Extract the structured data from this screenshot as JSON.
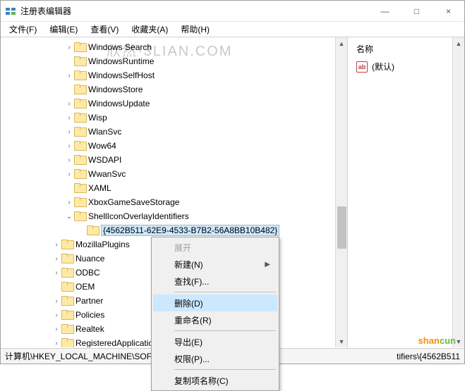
{
  "window": {
    "title": "注册表编辑器",
    "min": "—",
    "max": "□",
    "close": "×"
  },
  "menubar": [
    "文件(F)",
    "编辑(E)",
    "查看(V)",
    "收藏夹(A)",
    "帮助(H)"
  ],
  "watermark": "欣然·3LIAN.COM",
  "tree": {
    "items": [
      {
        "depth": 5,
        "exp": "›",
        "label": "Windows Search"
      },
      {
        "depth": 5,
        "exp": "",
        "label": "WindowsRuntime"
      },
      {
        "depth": 5,
        "exp": "›",
        "label": "WindowsSelfHost"
      },
      {
        "depth": 5,
        "exp": "",
        "label": "WindowsStore"
      },
      {
        "depth": 5,
        "exp": "›",
        "label": "WindowsUpdate"
      },
      {
        "depth": 5,
        "exp": "›",
        "label": "Wisp"
      },
      {
        "depth": 5,
        "exp": "›",
        "label": "WlanSvc"
      },
      {
        "depth": 5,
        "exp": "›",
        "label": "Wow64"
      },
      {
        "depth": 5,
        "exp": "›",
        "label": "WSDAPI"
      },
      {
        "depth": 5,
        "exp": "›",
        "label": "WwanSvc"
      },
      {
        "depth": 5,
        "exp": "",
        "label": "XAML"
      },
      {
        "depth": 5,
        "exp": "›",
        "label": "XboxGameSaveStorage"
      },
      {
        "depth": 5,
        "exp": "⌄",
        "label": "ShellIconOverlayIdentifiers"
      },
      {
        "depth": 6,
        "exp": "",
        "label": "{4562B511-62E9-4533-B7B2-56A8BB10B482}",
        "selected": true
      },
      {
        "depth": 4,
        "exp": "›",
        "label": "MozillaPlugins"
      },
      {
        "depth": 4,
        "exp": "›",
        "label": "Nuance"
      },
      {
        "depth": 4,
        "exp": "›",
        "label": "ODBC"
      },
      {
        "depth": 4,
        "exp": "",
        "label": "OEM"
      },
      {
        "depth": 4,
        "exp": "›",
        "label": "Partner"
      },
      {
        "depth": 4,
        "exp": "›",
        "label": "Policies"
      },
      {
        "depth": 4,
        "exp": "›",
        "label": "Realtek"
      },
      {
        "depth": 4,
        "exp": "›",
        "label": "RegisteredApplications"
      }
    ]
  },
  "right": {
    "header": "名称",
    "default_label": "(默认)",
    "icon_text": "ab"
  },
  "context_menu": {
    "items": [
      {
        "label": "展开",
        "disabled": true
      },
      {
        "label": "新建(N)",
        "submenu": true
      },
      {
        "label": "查找(F)..."
      },
      {
        "sep": true
      },
      {
        "label": "删除(D)",
        "highlight": true
      },
      {
        "label": "重命名(R)"
      },
      {
        "sep": true
      },
      {
        "label": "导出(E)"
      },
      {
        "label": "权限(P)..."
      },
      {
        "sep": true
      },
      {
        "label": "复制项名称(C)"
      }
    ]
  },
  "statusbar": {
    "path": "计算机\\HKEY_LOCAL_MACHINE\\SOFTWARE\\Mic",
    "path_tail": "tifiers\\{4562B511"
  },
  "watermark2": {
    "a": "shan",
    "b": "cun"
  }
}
